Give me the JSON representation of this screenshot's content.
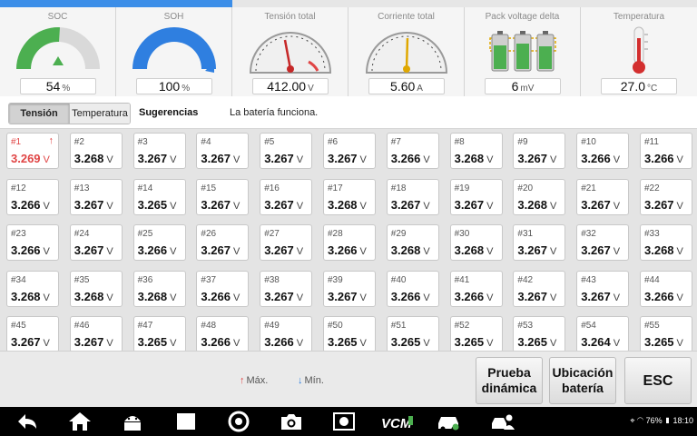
{
  "gauges": [
    {
      "title": "SOC",
      "value": "54",
      "unit": "%",
      "icon": "arc-gauge-green"
    },
    {
      "title": "SOH",
      "value": "100",
      "unit": "%",
      "icon": "arc-gauge-blue"
    },
    {
      "title": "Tensión total",
      "value": "412.00",
      "unit": "V",
      "icon": "speedometer-dial"
    },
    {
      "title": "Corriente total",
      "value": "5.60",
      "unit": "A",
      "icon": "speedometer-dial"
    },
    {
      "title": "Pack voltage delta",
      "value": "6",
      "unit": "mV",
      "icon": "battery-cells"
    },
    {
      "title": "Temperatura",
      "value": "27.0",
      "unit": "°C",
      "icon": "thermometer"
    }
  ],
  "tabs": [
    {
      "label": "Tensión",
      "active": true
    },
    {
      "label": "Temperatura",
      "active": false
    }
  ],
  "suggestions": {
    "label": "Sugerencias",
    "text": "La batería funciona."
  },
  "cells": [
    {
      "num": "#1",
      "val": "3.269",
      "max": true
    },
    {
      "num": "#2",
      "val": "3.268"
    },
    {
      "num": "#3",
      "val": "3.267"
    },
    {
      "num": "#4",
      "val": "3.267"
    },
    {
      "num": "#5",
      "val": "3.267"
    },
    {
      "num": "#6",
      "val": "3.267"
    },
    {
      "num": "#7",
      "val": "3.266"
    },
    {
      "num": "#8",
      "val": "3.268"
    },
    {
      "num": "#9",
      "val": "3.267"
    },
    {
      "num": "#10",
      "val": "3.266"
    },
    {
      "num": "#11",
      "val": "3.266"
    },
    {
      "num": "#12",
      "val": "3.266"
    },
    {
      "num": "#13",
      "val": "3.267"
    },
    {
      "num": "#14",
      "val": "3.265"
    },
    {
      "num": "#15",
      "val": "3.267"
    },
    {
      "num": "#16",
      "val": "3.267"
    },
    {
      "num": "#17",
      "val": "3.268"
    },
    {
      "num": "#18",
      "val": "3.267"
    },
    {
      "num": "#19",
      "val": "3.267"
    },
    {
      "num": "#20",
      "val": "3.268"
    },
    {
      "num": "#21",
      "val": "3.267"
    },
    {
      "num": "#22",
      "val": "3.267"
    },
    {
      "num": "#23",
      "val": "3.266"
    },
    {
      "num": "#24",
      "val": "3.267"
    },
    {
      "num": "#25",
      "val": "3.266"
    },
    {
      "num": "#26",
      "val": "3.267"
    },
    {
      "num": "#27",
      "val": "3.267"
    },
    {
      "num": "#28",
      "val": "3.266"
    },
    {
      "num": "#29",
      "val": "3.268"
    },
    {
      "num": "#30",
      "val": "3.268"
    },
    {
      "num": "#31",
      "val": "3.267"
    },
    {
      "num": "#32",
      "val": "3.267"
    },
    {
      "num": "#33",
      "val": "3.268"
    },
    {
      "num": "#34",
      "val": "3.268"
    },
    {
      "num": "#35",
      "val": "3.268"
    },
    {
      "num": "#36",
      "val": "3.268"
    },
    {
      "num": "#37",
      "val": "3.266"
    },
    {
      "num": "#38",
      "val": "3.267"
    },
    {
      "num": "#39",
      "val": "3.267"
    },
    {
      "num": "#40",
      "val": "3.266"
    },
    {
      "num": "#41",
      "val": "3.266"
    },
    {
      "num": "#42",
      "val": "3.267"
    },
    {
      "num": "#43",
      "val": "3.267"
    },
    {
      "num": "#44",
      "val": "3.266"
    },
    {
      "num": "#45",
      "val": "3.267"
    },
    {
      "num": "#46",
      "val": "3.267"
    },
    {
      "num": "#47",
      "val": "3.265"
    },
    {
      "num": "#48",
      "val": "3.266"
    },
    {
      "num": "#49",
      "val": "3.266"
    },
    {
      "num": "#50",
      "val": "3.265"
    },
    {
      "num": "#51",
      "val": "3.265"
    },
    {
      "num": "#52",
      "val": "3.265"
    },
    {
      "num": "#53",
      "val": "3.265"
    },
    {
      "num": "#54",
      "val": "3.264"
    },
    {
      "num": "#55",
      "val": "3.265"
    }
  ],
  "cell_unit": "V",
  "legend": {
    "max_label": "Máx.",
    "min_label": "Mín."
  },
  "buttons": {
    "dynamic_test": "Prueba dinámica",
    "battery_location": "Ubicación batería",
    "esc": "ESC"
  },
  "status": {
    "battery": "76%",
    "time": "18:10"
  },
  "colors": {
    "accent": "#3c8ee8",
    "soc_green": "#4caf50",
    "soh_blue": "#2f7fe0",
    "max_red": "#e04545",
    "min_blue": "#2f7fe0"
  }
}
